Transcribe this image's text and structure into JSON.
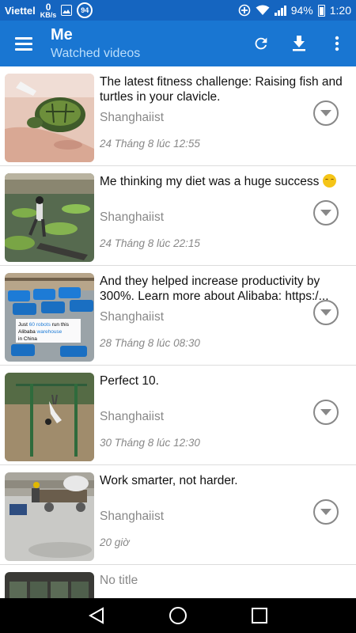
{
  "status_bar": {
    "carrier": "Viettel",
    "net_speed_value": "0",
    "net_speed_unit": "KB/s",
    "notification_badge": "94",
    "battery": "94%",
    "time": "1:20"
  },
  "toolbar": {
    "title": "Me",
    "subtitle": "Watched videos",
    "menu_icon": "hamburger-menu-icon",
    "refresh_icon": "refresh-icon",
    "download_icon": "download-icon",
    "overflow_icon": "more-vert-icon"
  },
  "videos": [
    {
      "title": "The latest fitness challenge: Raising fish and turtles in your clavicle.",
      "uploader": "Shanghaiist",
      "date": "24 Tháng 8 lúc 12:55",
      "thumbnail": "turtle-on-collarbone"
    },
    {
      "title": "Me thinking my diet was a huge success",
      "uploader": "Shanghaiist",
      "date": "24 Tháng 8 lúc 22:15",
      "thumbnail": "man-on-lily-pads",
      "emoji": "smiling-face-emoji"
    },
    {
      "title": "And they helped increase productivity by 300%. Learn more about Alibaba: https:/...",
      "uploader": "Shanghaiist",
      "date": "28 Tháng 8 lúc 08:30",
      "thumbnail": "warehouse-robots",
      "thumb_caption_1": "Just",
      "thumb_caption_2": "60 robots",
      "thumb_caption_3": "run this",
      "thumb_caption_4": "Alibaba",
      "thumb_caption_5": "warehouse",
      "thumb_caption_6": "in China"
    },
    {
      "title": "Perfect 10.",
      "uploader": "Shanghaiist",
      "date": "30 Tháng 8 lúc 12:30",
      "thumbnail": "man-on-horizontal-bar"
    },
    {
      "title": "Work smarter, not harder.",
      "uploader": "Shanghaiist",
      "date": "20 giờ",
      "thumbnail": "man-pulling-cart"
    },
    {
      "title": "No title",
      "uploader": "",
      "date": "",
      "thumbnail": "machines-row"
    }
  ],
  "nav_bar": {
    "back_icon": "back-triangle-icon",
    "home_icon": "home-circle-icon",
    "recents_icon": "recents-square-icon"
  },
  "colors": {
    "status_bar": "#1565c0",
    "toolbar": "#1976d2",
    "subtitle": "#bbdefb",
    "secondary_text": "#888888"
  }
}
